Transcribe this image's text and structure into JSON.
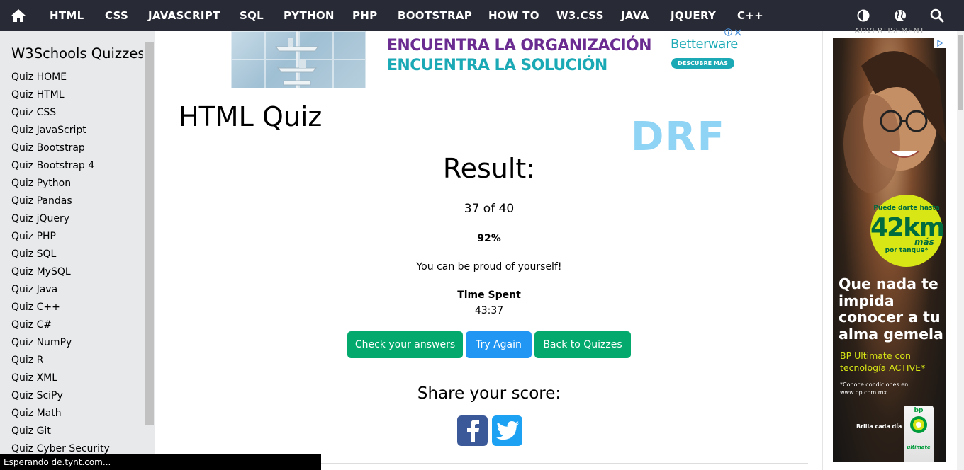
{
  "topnav": {
    "items": [
      "HTML",
      "CSS",
      "JAVASCRIPT",
      "SQL",
      "PYTHON",
      "PHP",
      "BOOTSTRAP",
      "HOW TO",
      "W3.CSS",
      "JAVA",
      "JQUERY",
      "C++"
    ],
    "icons": [
      "home-icon",
      "contrast-icon",
      "globe-icon",
      "search-icon"
    ],
    "background": "#282A35"
  },
  "sidebar": {
    "title": "W3Schools Quizzes",
    "links": [
      "Quiz HOME",
      "Quiz HTML",
      "Quiz CSS",
      "Quiz JavaScript",
      "Quiz Bootstrap",
      "Quiz Bootstrap 4",
      "Quiz Python",
      "Quiz Pandas",
      "Quiz jQuery",
      "Quiz PHP",
      "Quiz SQL",
      "Quiz MySQL",
      "Quiz Java",
      "Quiz C++",
      "Quiz C#",
      "Quiz NumPy",
      "Quiz R",
      "Quiz XML",
      "Quiz SciPy",
      "Quiz Math",
      "Quiz Git",
      "Quiz Cyber Security"
    ],
    "background": "#E7E9EB"
  },
  "ad_top": {
    "line1": "ENCUENTRA LA ORGANIZACIÓN",
    "line2": "ENCUENTRA LA SOLUCIÓN",
    "brand": "Betterware",
    "button": "DESCUBRE MÁS"
  },
  "main": {
    "title": "HTML Quiz",
    "drf_text": "DRF",
    "result_title": "Result:",
    "score": "37 of 40",
    "percent": "92%",
    "message": "You can be proud of yourself!",
    "time_label": "Time Spent",
    "time_value": "43:37",
    "buttons": {
      "check": "Check your answers",
      "try_again": "Try Again",
      "back": "Back to Quizzes"
    },
    "share_title": "Share your score:",
    "share_icons": [
      "facebook-icon",
      "twitter-icon"
    ],
    "colors": {
      "green": "#04AA6D",
      "blue": "#2196F3",
      "facebook": "#3B5998",
      "twitter": "#1DA1F2"
    }
  },
  "ad_right": {
    "label": "ADVERTISEMENT",
    "badge_top": "Puede darte hasta",
    "badge_number": "42km",
    "badge_extra": "más",
    "badge_bottom": "por tanque*",
    "headline": "Que nada te impida conocer a tu alma gemela",
    "sub": "BP Ultimate con tecnología ACTIVE*",
    "fine": "*Conoce condiciones en www.bp.com.mx",
    "tag": "Brilla cada día",
    "can_brand": "bp",
    "can_label": "ultimate"
  },
  "status_bar": {
    "text": "Esperando de.tynt.com..."
  }
}
